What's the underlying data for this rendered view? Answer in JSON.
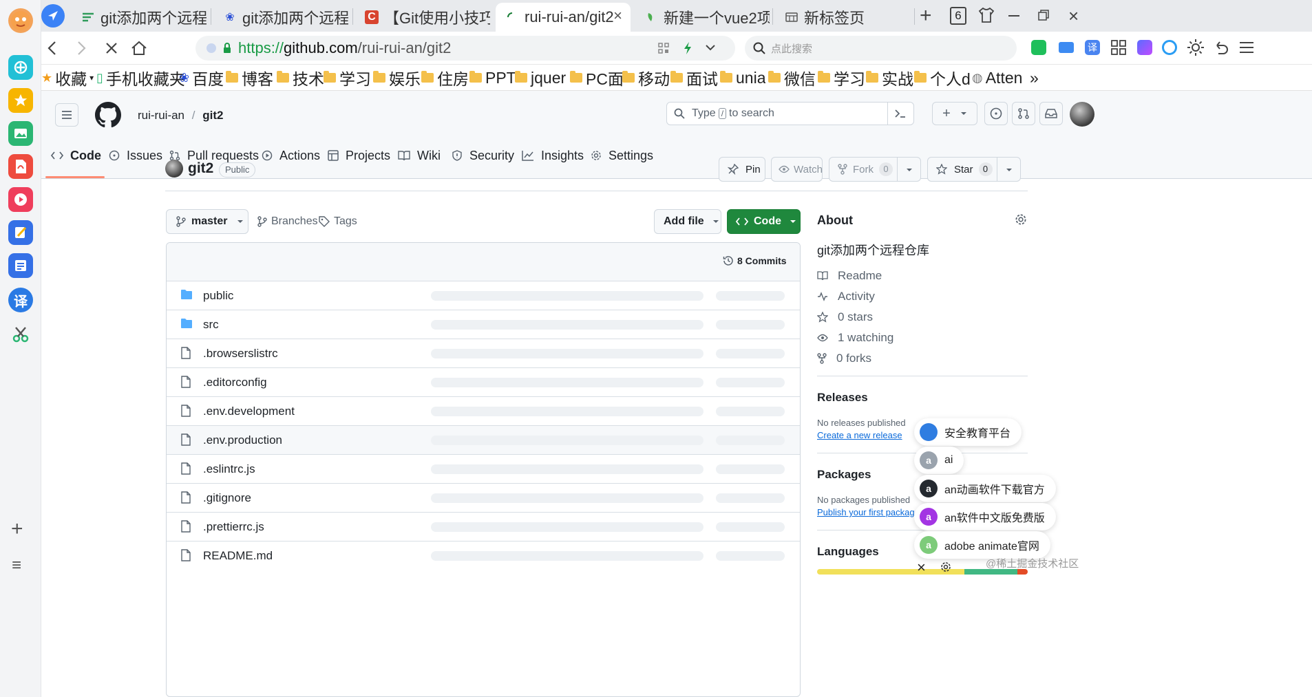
{
  "sidebar": {
    "icons": [
      "avatar",
      "plugin-icon",
      "star-icon",
      "image-ai-icon",
      "pdf-ai-icon",
      "video-ai-icon",
      "edit-ai-icon",
      "doc-ai-icon",
      "translate-icon",
      "scissors-icon"
    ],
    "translate_char": "译",
    "add_label": "+",
    "menu_label": "≡"
  },
  "tabs": [
    {
      "label": "git添加两个远程",
      "icon": "list-icon"
    },
    {
      "label": "git添加两个远程",
      "icon": "paw-icon"
    },
    {
      "label": "【Git使用小技巧",
      "icon": "c-icon",
      "icon_char": "C"
    },
    {
      "label": "rui-rui-an/git2",
      "icon": "loading-icon",
      "active": true
    },
    {
      "label": "新建一个vue2项",
      "icon": "vue-icon"
    },
    {
      "label": "新标签页",
      "icon": "newtab-icon"
    }
  ],
  "tab_count": "6",
  "tab_close": "×",
  "address": {
    "scheme": "https://",
    "host": "github.com",
    "path": "/rui-rui-an/git2"
  },
  "search_placeholder": "点此搜索",
  "toolbar_translate": "译",
  "bookmarks": [
    {
      "label": "收藏",
      "type": "star"
    },
    {
      "label": "手机收藏夹",
      "type": "phone"
    },
    {
      "label": "百度",
      "type": "paw"
    },
    {
      "label": "博客",
      "type": "folder"
    },
    {
      "label": "技术",
      "type": "folder"
    },
    {
      "label": "学习",
      "type": "folder"
    },
    {
      "label": "娱乐",
      "type": "folder"
    },
    {
      "label": "住房",
      "type": "folder"
    },
    {
      "label": "PPT",
      "type": "folder"
    },
    {
      "label": "jquer",
      "type": "folder"
    },
    {
      "label": "PC面",
      "type": "folder"
    },
    {
      "label": "移动",
      "type": "folder"
    },
    {
      "label": "面试",
      "type": "folder"
    },
    {
      "label": "unia",
      "type": "folder"
    },
    {
      "label": "微信",
      "type": "folder"
    },
    {
      "label": "学习",
      "type": "folder"
    },
    {
      "label": "实战",
      "type": "folder"
    },
    {
      "label": "个人d",
      "type": "folder"
    },
    {
      "label": "Atten",
      "type": "globe"
    }
  ],
  "bookmarks_more": "»",
  "github": {
    "owner": "rui-rui-an",
    "separator": "/",
    "repo": "git2",
    "search_prefix": "Type",
    "search_key": "/",
    "search_suffix": "to search",
    "plus": "+",
    "nav": [
      "Code",
      "Issues",
      "Pull requests",
      "Actions",
      "Projects",
      "Wiki",
      "Security",
      "Insights",
      "Settings"
    ],
    "visibility": "Public",
    "pin": "Pin",
    "watch": "Watch",
    "fork": "Fork",
    "fork_count": "0",
    "star": "Star",
    "star_count": "0",
    "branch": "master",
    "branches": "Branches",
    "tags": "Tags",
    "add_file": "Add file",
    "code_btn": "Code",
    "commits": "8 Commits",
    "files": [
      {
        "name": "public",
        "type": "dir"
      },
      {
        "name": "src",
        "type": "dir"
      },
      {
        "name": ".browserslistrc",
        "type": "file"
      },
      {
        "name": ".editorconfig",
        "type": "file"
      },
      {
        "name": ".env.development",
        "type": "file"
      },
      {
        "name": ".env.production",
        "type": "file"
      },
      {
        "name": ".eslintrc.js",
        "type": "file"
      },
      {
        "name": ".gitignore",
        "type": "file"
      },
      {
        "name": ".prettierrc.js",
        "type": "file"
      },
      {
        "name": "README.md",
        "type": "file"
      }
    ],
    "about": {
      "title": "About",
      "description": "git添加两个远程仓库",
      "readme": "Readme",
      "activity": "Activity",
      "stars": "0 stars",
      "watching": "1 watching",
      "forks": "0 forks"
    },
    "releases": {
      "title": "Releases",
      "none": "No releases published",
      "link": "Create a new release"
    },
    "packages": {
      "title": "Packages",
      "none": "No packages published",
      "link": "Publish your first package"
    },
    "languages": {
      "title": "Languages"
    }
  },
  "suggestions": [
    {
      "label": "安全教育平台",
      "avatar": "",
      "color": "#2f7de1"
    },
    {
      "label": "ai",
      "avatar": "a",
      "color": "#9aa3ad"
    },
    {
      "label": "an动画软件下载官方",
      "avatar": "a",
      "color": "#24292f"
    },
    {
      "label": "an软件中文版免费版",
      "avatar": "a",
      "color": "#a335e3"
    },
    {
      "label": "adobe animate官网",
      "avatar": "a",
      "color": "#7dcb7a"
    }
  ],
  "suggestions_close": "×",
  "watermark": "@稀土掘金技术社区",
  "colors": {
    "accent_green": "#1f883d",
    "link": "#0969da",
    "tab_bar": "#e8eaed",
    "gh_header": "#f6f8fa",
    "folder_blue": "#54aeff"
  }
}
